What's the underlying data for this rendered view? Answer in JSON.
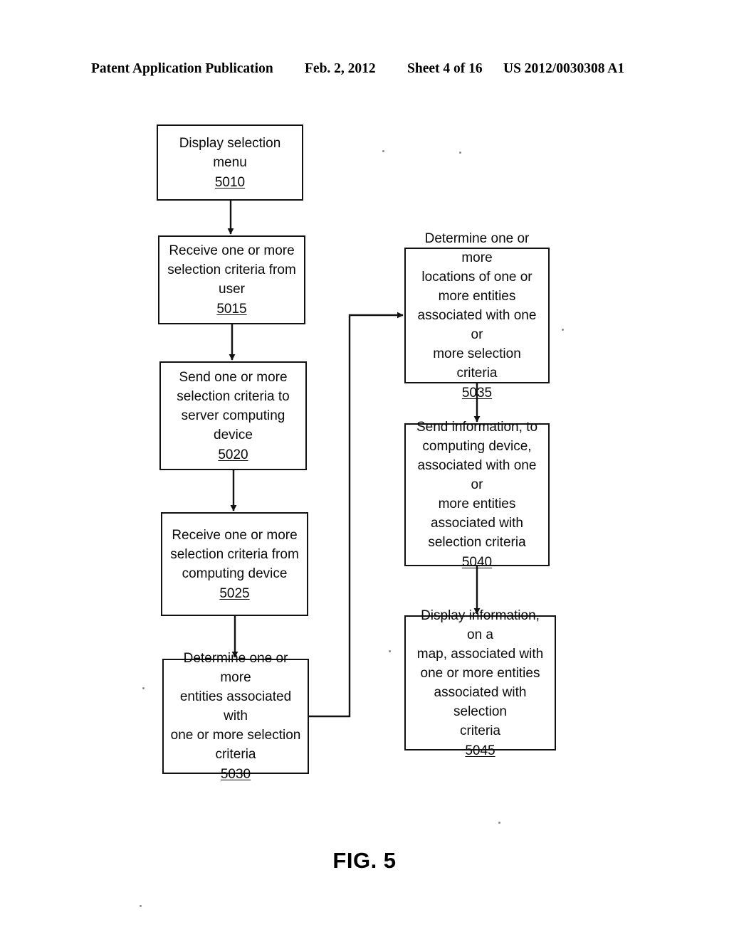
{
  "header": {
    "publication": "Patent Application Publication",
    "date": "Feb. 2, 2012",
    "sheet": "Sheet 4 of 16",
    "publication_number": "US 2012/0030308 A1"
  },
  "figure": {
    "caption": "FIG. 5"
  },
  "flowchart": {
    "nodes": [
      {
        "id": "5010",
        "text": "Display selection menu",
        "ref": "5010"
      },
      {
        "id": "5015",
        "text": "Receive one or more\nselection criteria from\nuser",
        "ref": "5015"
      },
      {
        "id": "5020",
        "text": "Send one or more\nselection criteria to\nserver computing\ndevice",
        "ref": "5020"
      },
      {
        "id": "5025",
        "text": "Receive one or more\nselection criteria from\ncomputing device",
        "ref": "5025"
      },
      {
        "id": "5030",
        "text": "Determine one or more\nentities associated with\none or more selection\ncriteria",
        "ref": "5030"
      },
      {
        "id": "5035",
        "text": "Determine one or more\nlocations of one or\nmore entities\nassociated with one or\nmore selection criteria",
        "ref": "5035"
      },
      {
        "id": "5040",
        "text": "Send information, to\ncomputing device,\nassociated with one or\nmore entities\nassociated with\nselection criteria",
        "ref": "5040"
      },
      {
        "id": "5045",
        "text": "Display information, on a\nmap, associated with\none or more entities\nassociated with selection\ncriteria",
        "ref": "5045"
      }
    ],
    "edges": [
      {
        "from": "5010",
        "to": "5015"
      },
      {
        "from": "5015",
        "to": "5020"
      },
      {
        "from": "5020",
        "to": "5025"
      },
      {
        "from": "5025",
        "to": "5030"
      },
      {
        "from": "5030",
        "to": "5035"
      },
      {
        "from": "5035",
        "to": "5040"
      },
      {
        "from": "5040",
        "to": "5045"
      }
    ]
  },
  "colors": {
    "ink": "#111111",
    "page": "#ffffff"
  }
}
